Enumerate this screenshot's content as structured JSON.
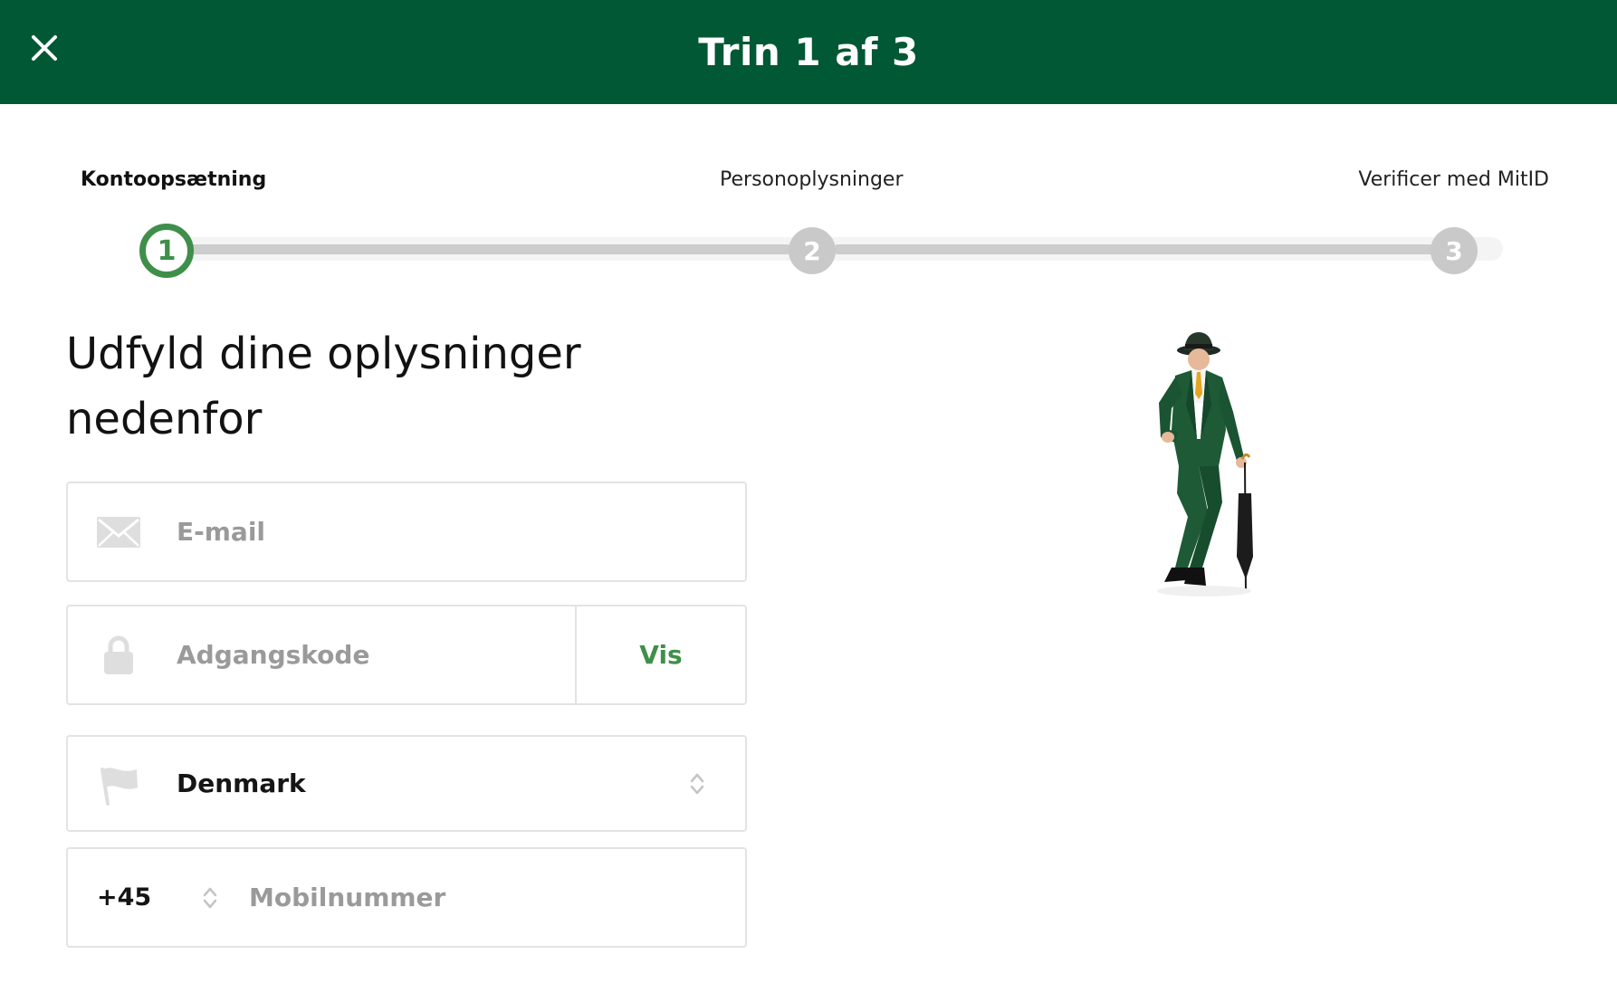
{
  "header": {
    "title": "Trin 1 af 3"
  },
  "stepper": {
    "steps": [
      {
        "label": "Kontoopsætning",
        "number": "1",
        "state": "active"
      },
      {
        "label": "Personoplysninger",
        "number": "2",
        "state": "inactive"
      },
      {
        "label": "Verificer med MitID",
        "number": "3",
        "state": "inactive"
      }
    ]
  },
  "main": {
    "heading": "Udfyld dine oplysninger nedenfor"
  },
  "form": {
    "email": {
      "placeholder": "E-mail",
      "value": ""
    },
    "password": {
      "placeholder": "Adgangskode",
      "value": "",
      "toggle_label": "Vis"
    },
    "country": {
      "selected": "Denmark"
    },
    "phone": {
      "dial_code": "+45",
      "placeholder": "Mobilnummer",
      "value": ""
    }
  },
  "colors": {
    "brand": "#005835",
    "accent": "#3f8f4a",
    "inactive_step": "#c9c9c9"
  },
  "icons": [
    "close-icon",
    "envelope-icon",
    "lock-icon",
    "flag-icon",
    "chevron-updown-icon"
  ]
}
